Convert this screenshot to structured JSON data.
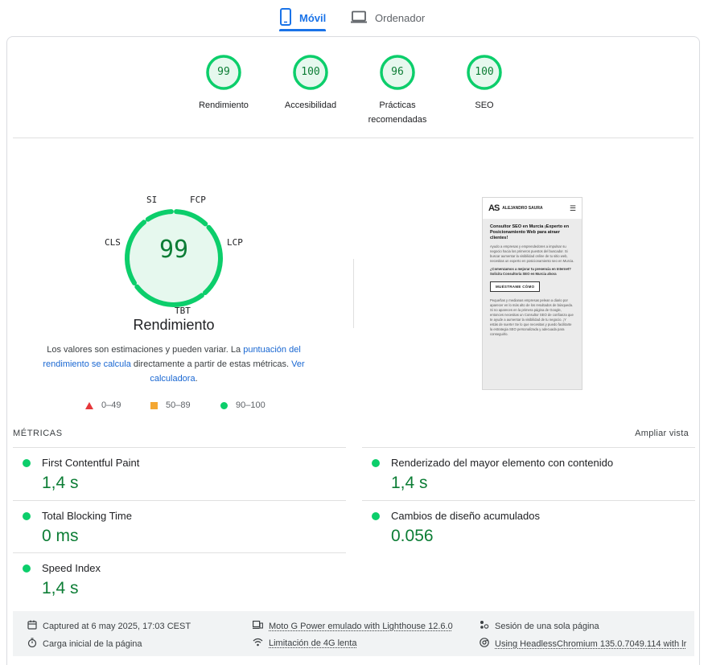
{
  "tabs": {
    "mobile": "Móvil",
    "desktop": "Ordenador"
  },
  "scores": [
    {
      "value": "99",
      "label": "Rendimiento"
    },
    {
      "value": "100",
      "label": "Accesibilidad"
    },
    {
      "value": "96",
      "label": "Prácticas recomendadas"
    },
    {
      "value": "100",
      "label": "SEO"
    }
  ],
  "performance": {
    "score": "99",
    "title": "Rendimiento",
    "tags": {
      "si": "SI",
      "fcp": "FCP",
      "lcp": "LCP",
      "tbt": "TBT",
      "cls": "CLS"
    },
    "desc_1": "Los valores son estimaciones y pueden variar. La ",
    "desc_link_1": "puntuación del rendimiento se calcula",
    "desc_2": " directamente a partir de estas métricas. ",
    "desc_link_2": "Ver calculadora",
    "desc_3": "."
  },
  "legend": {
    "bad": "0–49",
    "avg": "50–89",
    "good": "90–100"
  },
  "preview": {
    "brand": "ALEJANDRO SAURA",
    "heading": "Consultor SEO en Murcia ¡Experto en Posicionamiento Web para atraer clientes!",
    "para1": "Ayudo a empresas y emprendedores a impulsar su negocio hacia los primeros puestos del buscador. Si buscar aumentar la visibilidad online de tu sitio web, necesitas un experto en posicionamiento seo en Murcia.",
    "cta_text": "¿Comenzamos a mejorar tu presencia en Internet? Solicita Consultoría SEO en Murcia ahora",
    "button": "MUÉSTRAME CÓMO",
    "para2": "Pequeñas y medianas empresas pelean a diario por aparecer en lo más alto de los resultados de búsqueda. Si no apareces en la primera página de Google, entonces necesitas un Consultor SEO de confianza que te ayude a aumentar la visibilidad de tu negocio. ¡Y estás de suerte! Se lo que necesitas y puedo facilitarte la estrategia SEO personalizada y adecuada para conseguirlo."
  },
  "metrics": {
    "title": "MÉTRICAS",
    "expand": "Ampliar vista",
    "items": [
      {
        "name": "First Contentful Paint",
        "value": "1,4 s"
      },
      {
        "name": "Renderizado del mayor elemento con contenido",
        "value": "1,4 s"
      },
      {
        "name": "Total Blocking Time",
        "value": "0 ms"
      },
      {
        "name": "Cambios de diseño acumulados",
        "value": "0.056"
      },
      {
        "name": "Speed Index",
        "value": "1,4 s"
      }
    ]
  },
  "info": {
    "captured": "Captured at 6 may 2025, 17:03 CEST",
    "load": "Carga inicial de la página",
    "device": "Moto G Power emulado with Lighthouse 12.6.0",
    "network": "Limitación de 4G lenta",
    "session": "Sesión de una sola página",
    "browser": "Using HeadlessChromium 135.0.7049.114 with lr"
  },
  "colors": {
    "good": "#0cce6b",
    "good_text": "#0c7d35",
    "good_fill": "#e6f8ee",
    "accent": "#1a73e8"
  }
}
